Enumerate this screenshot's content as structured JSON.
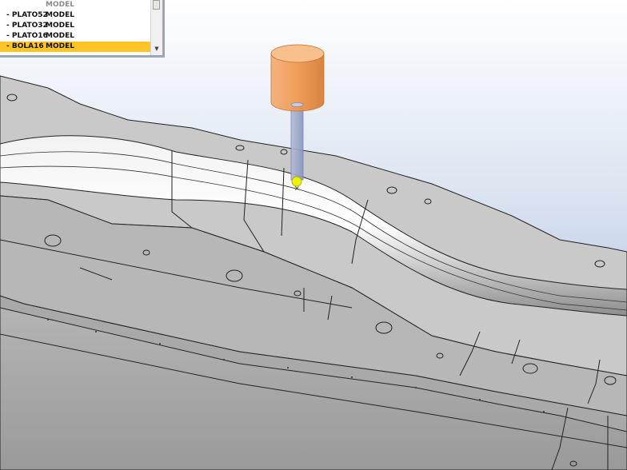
{
  "tool_list": {
    "rows": [
      {
        "name": "",
        "type": "MODEL",
        "state": "dim"
      },
      {
        "name": "- PLATO52",
        "type": "MODEL",
        "state": "normal"
      },
      {
        "name": "- PLATO32",
        "type": "MODEL",
        "state": "normal"
      },
      {
        "name": "- PLATO16",
        "type": "MODEL",
        "state": "normal"
      },
      {
        "name": "- BOLA16",
        "type": "MODEL",
        "state": "selected"
      }
    ],
    "scroll_down_glyph": "▼"
  },
  "viewport": {
    "background_top": "#ffffff",
    "background_bottom": "#9fb7df",
    "part_color": "#c8c8c8",
    "tool_holder_color": "#f0a050",
    "tool_shank_color": "#9aa7c8",
    "tool_tip_color": "#f0f000"
  }
}
